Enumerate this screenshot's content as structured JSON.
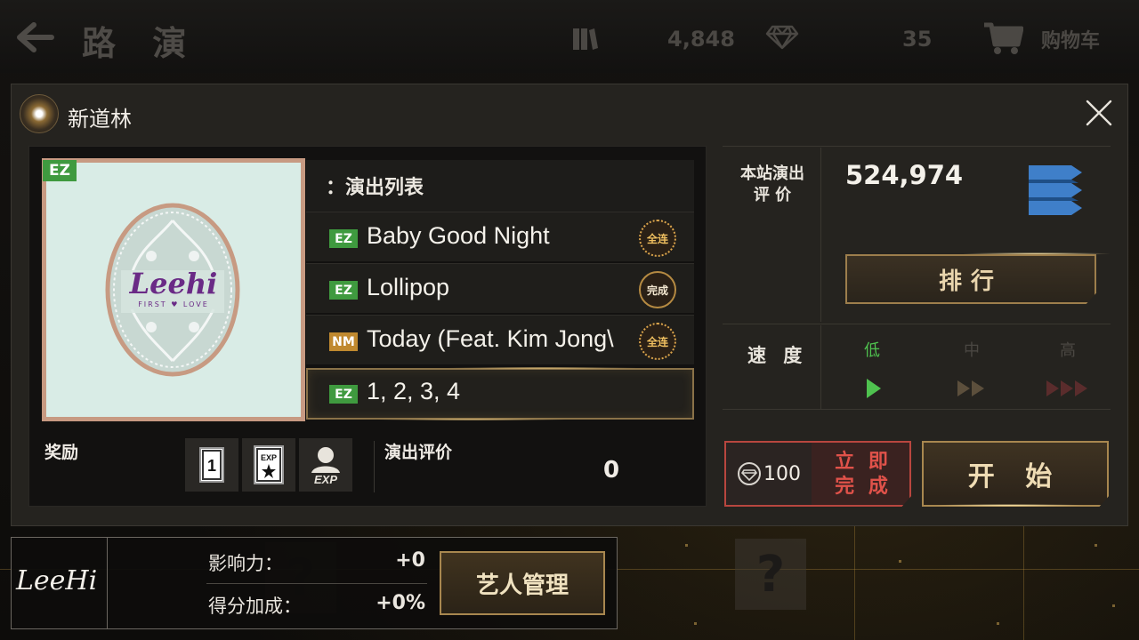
{
  "topbar": {
    "title": "路 演",
    "coins": "4,848",
    "gems": "35",
    "cart_label": "购物车"
  },
  "modal": {
    "venue_name": "新道林",
    "album": {
      "difficulty": "EZ",
      "logo_text": "Leehi",
      "logo_subtitle": "FIRST ♥ LOVE"
    },
    "setlist_header": "：演出列表",
    "songs": [
      {
        "level": "EZ",
        "title": "Baby Good Night",
        "medal": "全连",
        "selected": false
      },
      {
        "level": "EZ",
        "title": "Lollipop",
        "medal": "完成",
        "selected": false
      },
      {
        "level": "NM",
        "title": "Today (Feat. Kim Jong\\",
        "medal": "全连",
        "selected": false
      },
      {
        "level": "EZ",
        "title": "1, 2, 3, 4",
        "medal": "",
        "selected": true
      }
    ],
    "rewards": {
      "label": "奖励",
      "items": [
        "1",
        "EXP",
        "EXP"
      ]
    },
    "performance": {
      "label": "演出评价",
      "value": "0"
    },
    "score": {
      "label_line1": "本站演出",
      "label_line2": "评 价",
      "value": "524,974"
    },
    "rank_button": "排行",
    "speed": {
      "label": "速 度",
      "options": [
        "低",
        "中",
        "高"
      ],
      "selected": "低"
    },
    "instant_complete": {
      "cost": "100",
      "label_line1": "立 即",
      "label_line2": "完 成"
    },
    "start_button": "开 始"
  },
  "artist": {
    "logo": "LeeHi",
    "influence_label": "影响力：",
    "influence_value": "+0",
    "bonus_label": "得分加成：",
    "bonus_value": "+0%",
    "manage_button": "艺人管理"
  },
  "colors": {
    "ez_green": "#3f9a3f",
    "nm_orange": "#c0892f",
    "gold_border": "#a8874f",
    "instant_red": "#e0524a",
    "speed_active": "#4fc24f",
    "rank_blue": "#3f7fc9"
  }
}
